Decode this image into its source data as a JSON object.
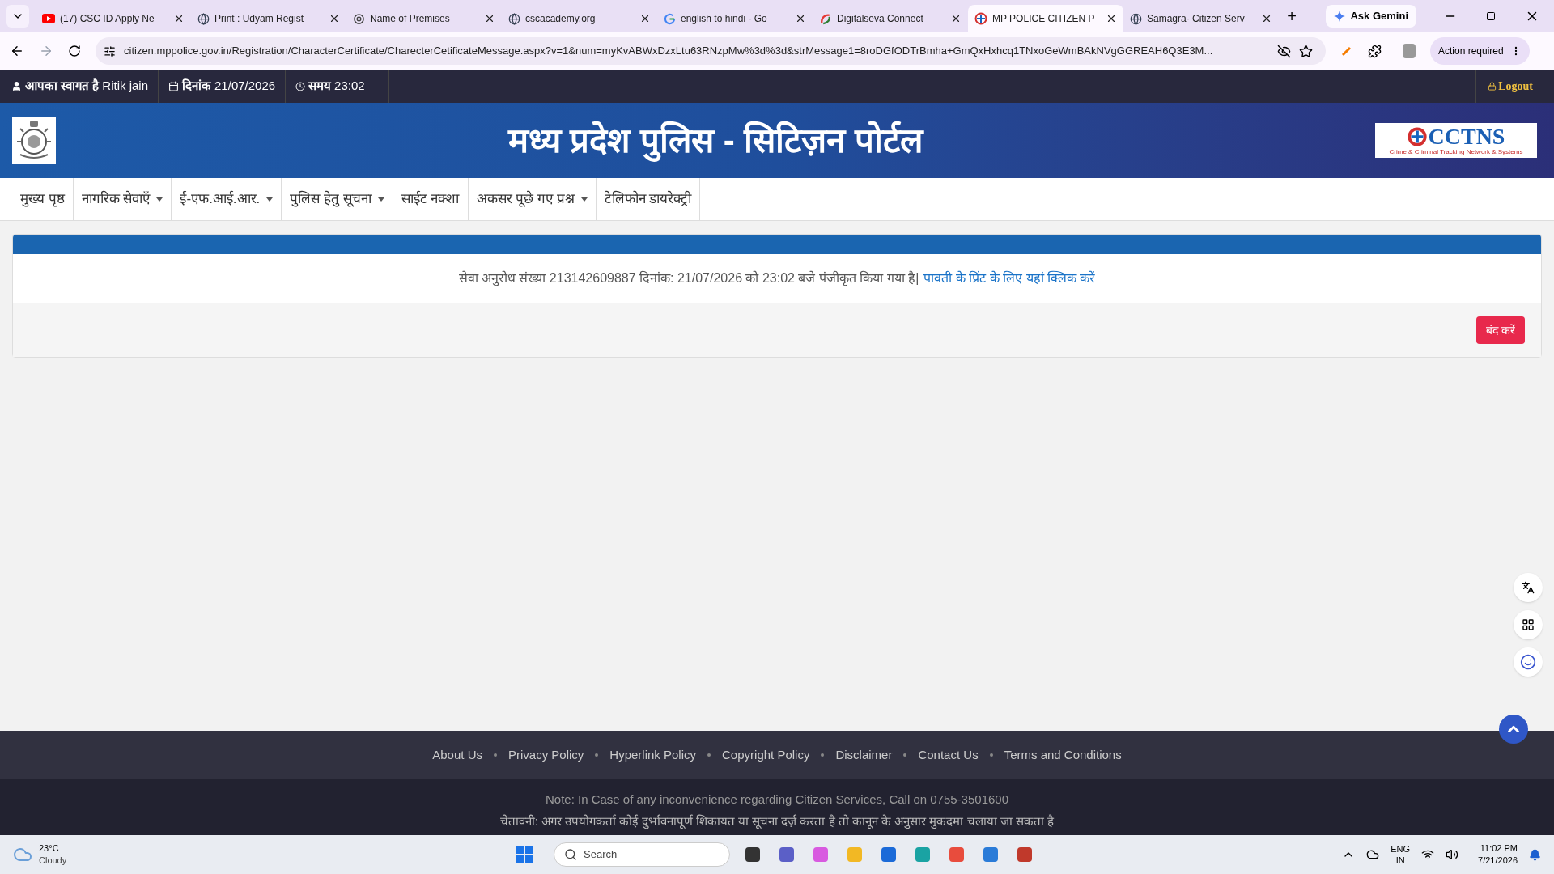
{
  "browser": {
    "tabs": [
      {
        "title": "(17) CSC ID Apply Ne",
        "kind": "video",
        "selected": false
      },
      {
        "title": "Print : Udyam Regist",
        "kind": "globe",
        "selected": false
      },
      {
        "title": "Name of Premises",
        "kind": "spark",
        "selected": false
      },
      {
        "title": "cscacademy.org",
        "kind": "globe",
        "selected": false
      },
      {
        "title": "english to hindi - Go",
        "kind": "google",
        "selected": false
      },
      {
        "title": "Digitalseva Connect",
        "kind": "seva",
        "selected": false
      },
      {
        "title": "MP POLICE CITIZEN P",
        "kind": "police",
        "selected": true
      },
      {
        "title": "Samagra- Citizen Serv",
        "kind": "globe",
        "selected": false
      }
    ],
    "new_tab": "+",
    "gemini": "Ask Gemini",
    "url": "citizen.mppolice.gov.in/Registration/CharacterCertificate/CharecterCetificateMessage.aspx?v=1&num=myKvABWxDzxLtu63RNzpMw%3d%3d&strMessage1=8roDGfODTrBmha+GmQxHxhcq1TNxoGeWmBAkNVgGGREAH6Q3E3M...",
    "action": "Action required"
  },
  "topbar": {
    "welcome_label": "आपका स्वागत है",
    "user": "Ritik jain",
    "date_label": "दिनांक",
    "date": "21/07/2026",
    "time_label": "समय",
    "time": "23:02",
    "logout": "Logout"
  },
  "header": {
    "title": "मध्य प्रदेश पुलिस - सिटिज़न पोर्टल",
    "logo_text": "CCTNS",
    "logo_tagline": "Crime & Criminal Tracking Network & Systems"
  },
  "nav": [
    {
      "label": "मुख्य पृष्ठ",
      "dropdown": false
    },
    {
      "label": "नागरिक सेवाएँ",
      "dropdown": true
    },
    {
      "label": "ई-एफ.आई.आर.",
      "dropdown": true
    },
    {
      "label": "पुलिस हेतु सूचना",
      "dropdown": true
    },
    {
      "label": "साईट नक्शा",
      "dropdown": false
    },
    {
      "label": "अकसर पूछे गए प्रश्न",
      "dropdown": true
    },
    {
      "label": "टेलिफोन डायरेक्ट्री",
      "dropdown": false
    }
  ],
  "message": {
    "text": "सेवा अनुरोध संख्या 213142609887 दिनांक: 21/07/2026 को 23:02 बजे पंजीकृत किया गया है|",
    "link": "पावती के प्रिंट के लिए यहां क्लिक करें",
    "close": "बंद करें"
  },
  "footer": {
    "links": [
      "About Us",
      "Privacy Policy",
      "Hyperlink Policy",
      "Copyright Policy",
      "Disclaimer",
      "Contact Us",
      "Terms and Conditions"
    ],
    "note": "Note: In Case of any inconvenience regarding Citizen Services, Call on 0755-3501600",
    "warning": "चेतावनी: अगर उपयोगकर्ता कोई दुर्भावनापूर्ण शिकायत या सूचना दर्ज़ करता है तो कानून के अनुसार मुकदमा चलाया जा सकता है"
  },
  "taskbar": {
    "temp": "23°C",
    "weather": "Cloudy",
    "search": "Search",
    "lang": "ENG",
    "region": "IN",
    "time": "11:02 PM",
    "date": "7/21/2026"
  }
}
